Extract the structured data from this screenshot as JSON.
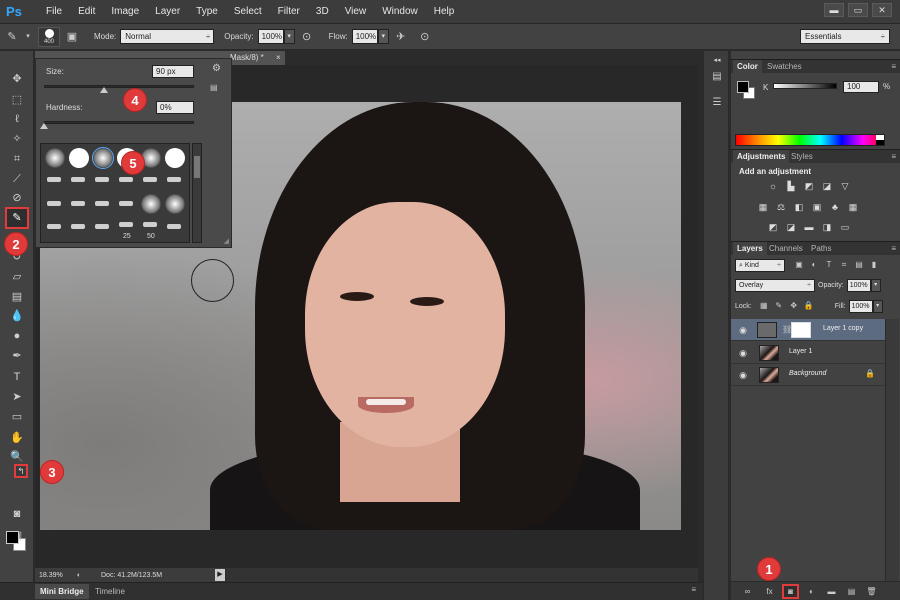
{
  "app": {
    "logo": "Ps",
    "menu": [
      "File",
      "Edit",
      "Image",
      "Layer",
      "Type",
      "Select",
      "Filter",
      "3D",
      "View",
      "Window",
      "Help"
    ],
    "window_controls": [
      "▬",
      "▭",
      "✕"
    ]
  },
  "options_bar": {
    "brush_size_label": "400",
    "mode_label": "Mode:",
    "mode_value": "Normal",
    "opacity_label": "Opacity:",
    "opacity_value": "100%",
    "flow_label": "Flow:",
    "flow_value": "100%",
    "workspace": "Essentials"
  },
  "document": {
    "tab_title": "Mask/8) *",
    "tab_close": "×"
  },
  "brush_popup": {
    "size_label": "Size:",
    "size_value": "90 px",
    "size_percent": 0.4,
    "hardness_label": "Hardness:",
    "hardness_value": "0%",
    "hardness_percent": 0.0,
    "tip_labels": [
      "25",
      "50"
    ]
  },
  "color_panel": {
    "tabs": [
      "Color",
      "Swatches"
    ],
    "channel_label": "K",
    "value": "100",
    "unit": "%"
  },
  "adjustments_panel": {
    "tabs": [
      "Adjustments",
      "Styles"
    ],
    "title": "Add an adjustment"
  },
  "layers_panel": {
    "tabs": [
      "Layers",
      "Channels",
      "Paths"
    ],
    "filter_kind": "Kind",
    "blend_mode": "Overlay",
    "opacity_label": "Opacity:",
    "opacity_value": "100%",
    "lock_label": "Lock:",
    "fill_label": "Fill:",
    "fill_value": "100%",
    "layers": [
      {
        "name": "Layer 1 copy",
        "selected": true
      },
      {
        "name": "Layer 1",
        "selected": false
      },
      {
        "name": "Background",
        "selected": false,
        "locked": true
      }
    ]
  },
  "status_bar": {
    "zoom": "18.39%",
    "doc_info": "Doc: 41.2M/123.5M"
  },
  "bottom_tabs": [
    "Mini Bridge",
    "Timeline"
  ],
  "markers": [
    "1",
    "2",
    "3",
    "4",
    "5"
  ],
  "colors": {
    "marker": "#e03a3a",
    "selected_layer": "#5d6b80",
    "logo": "#31a8ff"
  }
}
